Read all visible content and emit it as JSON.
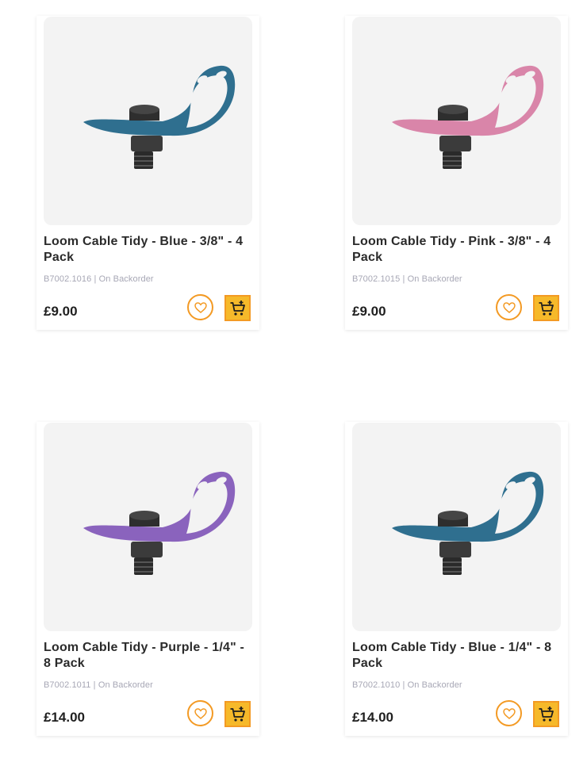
{
  "products": [
    {
      "title": "Loom Cable Tidy - Blue - 3/8\" - 4 Pack",
      "sku": "B7002.1016",
      "stock": "On Backorder",
      "price": "£9.00",
      "color": "#2f6f8f",
      "icons": {
        "wishlist": "heart-icon",
        "cart": "cart-plus-icon"
      }
    },
    {
      "title": "Loom Cable Tidy - Pink - 3/8\" - 4 Pack",
      "sku": "B7002.1015",
      "stock": "On Backorder",
      "price": "£9.00",
      "color": "#d985a9",
      "icons": {
        "wishlist": "heart-icon",
        "cart": "cart-plus-icon"
      }
    },
    {
      "title": "Loom Cable Tidy - Purple - 1/4\" - 8 Pack",
      "sku": "B7002.1011",
      "stock": "On Backorder",
      "price": "£14.00",
      "color": "#8a63bd",
      "icons": {
        "wishlist": "heart-icon",
        "cart": "cart-plus-icon"
      }
    },
    {
      "title": "Loom Cable Tidy - Blue - 1/4\" - 8 Pack",
      "sku": "B7002.1010",
      "stock": "On Backorder",
      "price": "£14.00",
      "color": "#2f6f8f",
      "icons": {
        "wishlist": "heart-icon",
        "cart": "cart-plus-icon"
      }
    }
  ],
  "theme": {
    "accent": "#f39a24",
    "cart_fill": "#f6b92a"
  }
}
